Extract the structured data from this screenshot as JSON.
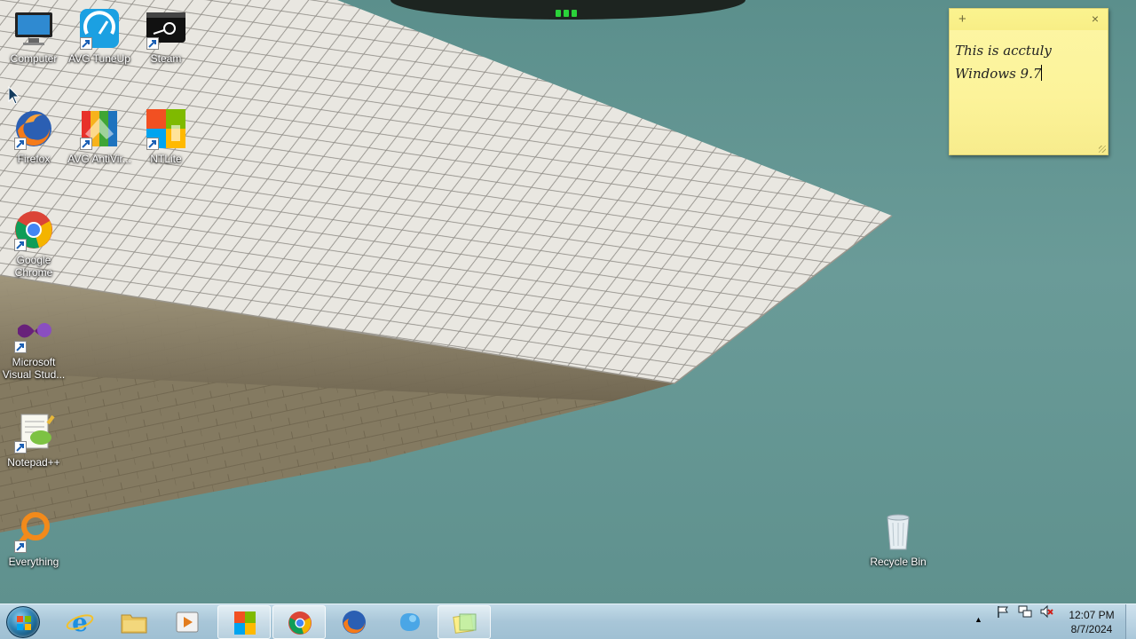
{
  "desktop": {
    "icons": [
      {
        "label": "Computer",
        "icon": "computer-icon"
      },
      {
        "label": "AVG TuneUp",
        "icon": "avg-tuneup-icon"
      },
      {
        "label": "Steam",
        "icon": "steam-icon"
      },
      {
        "label": "Firefox",
        "icon": "firefox-icon"
      },
      {
        "label": "AVG AntiVir...",
        "icon": "avg-antivirus-icon"
      },
      {
        "label": "NTLite",
        "icon": "ntlite-icon"
      },
      {
        "label": "Google Chrome",
        "icon": "chrome-icon"
      },
      {
        "label": "Microsoft Visual Stud...",
        "icon": "visual-studio-icon"
      },
      {
        "label": "Notepad++",
        "icon": "notepad-plus-plus-icon"
      },
      {
        "label": "Everything",
        "icon": "everything-search-icon"
      },
      {
        "label": "Recycle Bin",
        "icon": "recycle-bin-icon"
      }
    ]
  },
  "sticky_note": {
    "add_label": "+",
    "close_label": "×",
    "line1": "This is acctuly",
    "line2": "Windows 9.7"
  },
  "taskbar": {
    "start_icon": "windows-orb-icon",
    "items": [
      {
        "name": "internet-explorer",
        "icon": "internet-explorer-icon",
        "state": "pinned"
      },
      {
        "name": "file-explorer",
        "icon": "folder-icon",
        "state": "pinned"
      },
      {
        "name": "media-player",
        "icon": "media-player-icon",
        "state": "pinned"
      },
      {
        "name": "ntlite",
        "icon": "ntlite-icon",
        "state": "running"
      },
      {
        "name": "chrome",
        "icon": "chrome-icon",
        "state": "running"
      },
      {
        "name": "firefox",
        "icon": "firefox-icon",
        "state": "pinned"
      },
      {
        "name": "app-blue",
        "icon": "blue-app-icon",
        "state": "pinned"
      },
      {
        "name": "sticky-notes",
        "icon": "sticky-notes-icon",
        "state": "running"
      }
    ],
    "tray": {
      "icons": [
        "show-hidden-icons",
        "flag-icon",
        "network-icon",
        "volume-muted-icon"
      ],
      "chevron": "▲",
      "time": "12:07 PM",
      "date": "8/7/2024"
    }
  },
  "colors": {
    "desktop_teal": "#5f928f",
    "sticky_yellow": "#fcf39a",
    "taskbar_blue": "#a8c6d8"
  }
}
